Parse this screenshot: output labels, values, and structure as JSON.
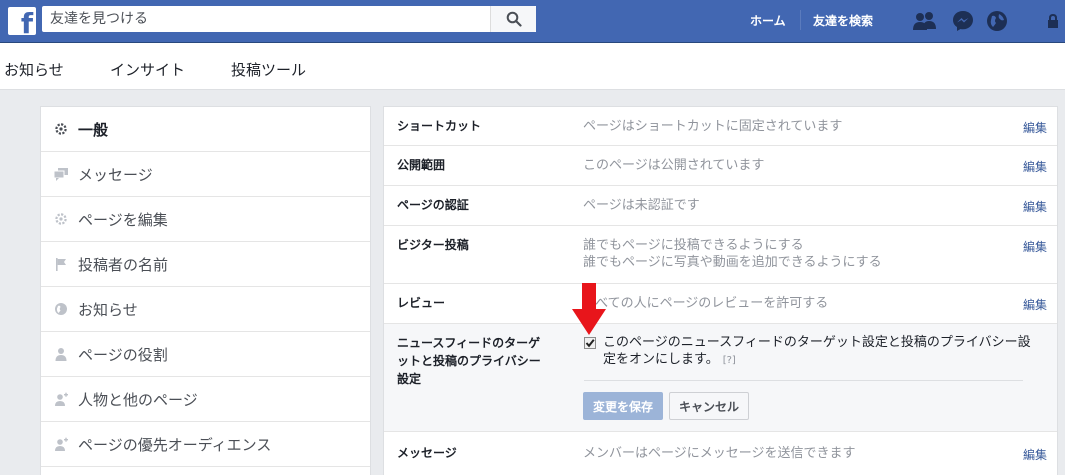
{
  "topbar": {
    "logo": "f",
    "search": {
      "placeholder": "友達を見つける"
    },
    "nav": {
      "home": "ホーム",
      "find_friends": "友達を検索"
    },
    "icons": [
      "friend-requests-icon",
      "messenger-icon",
      "notifications-globe-icon",
      "privacy-lock-icon"
    ],
    "brand_color": "#4267b2"
  },
  "tabs": [
    "お知らせ",
    "インサイト",
    "投稿ツール"
  ],
  "sidebar": {
    "items": [
      {
        "label": "一般",
        "icon": "gear-icon",
        "active": true
      },
      {
        "label": "メッセージ",
        "icon": "chat-bubbles-icon"
      },
      {
        "label": "ページを編集",
        "icon": "gear-icon"
      },
      {
        "label": "投稿者の名前",
        "icon": "flag-icon"
      },
      {
        "label": "お知らせ",
        "icon": "globe-icon"
      },
      {
        "label": "ページの役割",
        "icon": "person-icon"
      },
      {
        "label": "人物と他のページ",
        "icon": "person-plus-icon"
      },
      {
        "label": "ページの優先オーディエンス",
        "icon": "person-plus-icon"
      }
    ]
  },
  "settings": {
    "edit_label": "編集",
    "rows": [
      {
        "label": "ショートカット",
        "value": "ページはショートカットに固定されています"
      },
      {
        "label": "公開範囲",
        "value": "このページは公開されています"
      },
      {
        "label": "ページの認証",
        "value": "ページは未認証です"
      },
      {
        "label": "ビジター投稿",
        "value": "誰でもページに投稿できるようにする",
        "value2": "誰でもページに写真や動画を追加できるようにする"
      },
      {
        "label": "レビュー",
        "value": "すべての人にページのレビューを許可する"
      },
      {
        "label": "メッセージ",
        "value": "メンバーはページにメッセージを送信できます"
      }
    ],
    "expanded": {
      "label_lines": [
        "ニュースフィードのターゲ",
        "ットと投稿のプライバシー",
        "設定"
      ],
      "checked": true,
      "description": "このページのニュースフィードのターゲット設定と投稿のプライバシー設定をオンにします。",
      "help": "[?]",
      "save_label": "変更を保存",
      "cancel_label": "キャンセル"
    }
  }
}
